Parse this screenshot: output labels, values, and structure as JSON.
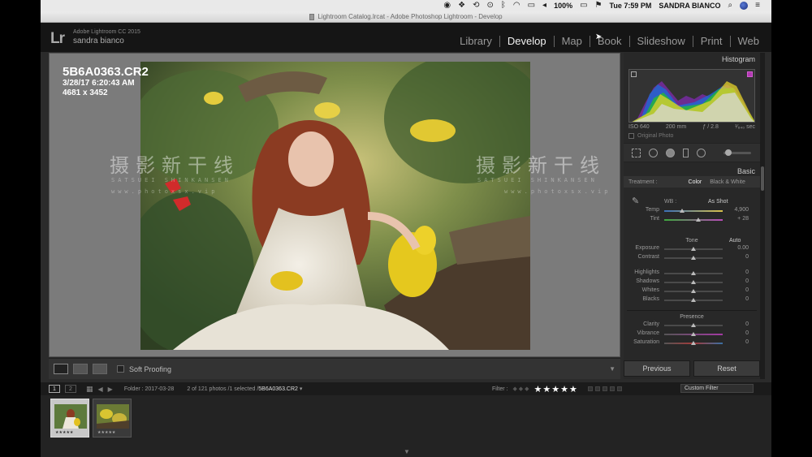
{
  "menubar": {
    "battery": "100%",
    "time": "Tue 7:59 PM",
    "user": "SANDRA BIANCO"
  },
  "window": {
    "title": "Lightroom Catalog.lrcat - Adobe Photoshop Lightroom - Develop"
  },
  "app": {
    "logo": "Lr",
    "version": "Adobe Lightroom CC 2015",
    "user": "sandra bianco"
  },
  "modules": [
    {
      "label": "Library",
      "active": false
    },
    {
      "label": "Develop",
      "active": true
    },
    {
      "label": "Map",
      "active": false
    },
    {
      "label": "Book",
      "active": false
    },
    {
      "label": "Slideshow",
      "active": false
    },
    {
      "label": "Print",
      "active": false
    },
    {
      "label": "Web",
      "active": false
    }
  ],
  "image_info": {
    "filename": "5B6A0363.CR2",
    "datetime": "3/28/17 6:20:43 AM",
    "dimensions": "4681 x 3452"
  },
  "watermark": {
    "text": "摄影新干线",
    "sub": "SATSUEI SHINKANSEN",
    "url": "www.photoxsx.vip"
  },
  "toolbar": {
    "soft_proofing": "Soft Proofing"
  },
  "right_panel": {
    "histogram_title": "Histogram",
    "exif": {
      "iso": "ISO 640",
      "focal": "200 mm",
      "aperture": "ƒ / 2.8",
      "shutter": "¹⁄₆₄₀ sec"
    },
    "original_photo": "Original Photo",
    "basic_title": "Basic",
    "treatment_label": "Treatment :",
    "treatment_color": "Color",
    "treatment_bw": "Black & White",
    "wb_label": "WB :",
    "wb_value": "As Shot",
    "tone_label": "Tone",
    "auto_label": "Auto",
    "presence_label": "Presence",
    "sliders": {
      "temp": {
        "label": "Temp",
        "value": "4,900",
        "pos": 0.3
      },
      "tint": {
        "label": "Tint",
        "value": "+ 28",
        "pos": 0.58
      },
      "exposure": {
        "label": "Exposure",
        "value": "0.00",
        "pos": 0.5
      },
      "contrast": {
        "label": "Contrast",
        "value": "0",
        "pos": 0.5
      },
      "highlights": {
        "label": "Highlights",
        "value": "0",
        "pos": 0.5
      },
      "shadows": {
        "label": "Shadows",
        "value": "0",
        "pos": 0.5
      },
      "whites": {
        "label": "Whites",
        "value": "0",
        "pos": 0.5
      },
      "blacks": {
        "label": "Blacks",
        "value": "0",
        "pos": 0.5
      },
      "clarity": {
        "label": "Clarity",
        "value": "0",
        "pos": 0.5
      },
      "vibrance": {
        "label": "Vibrance",
        "value": "0",
        "pos": 0.5
      },
      "saturation": {
        "label": "Saturation",
        "value": "0",
        "pos": 0.5
      }
    },
    "previous_label": "Previous",
    "reset_label": "Reset"
  },
  "filmstrip_header": {
    "view1": "1",
    "view2": "2",
    "folder": "Folder : 2017-03-28",
    "count": "2 of 121 photos /1 selected /",
    "current": "5B6A0363.CR2",
    "filter_label": "Filter :",
    "stars": "★★★★★",
    "custom_filter": "Custom Filter"
  },
  "colors": {
    "accent_active": "#f2f2f2",
    "panel_bg": "#282828",
    "center_bg": "#7b7b7b"
  }
}
